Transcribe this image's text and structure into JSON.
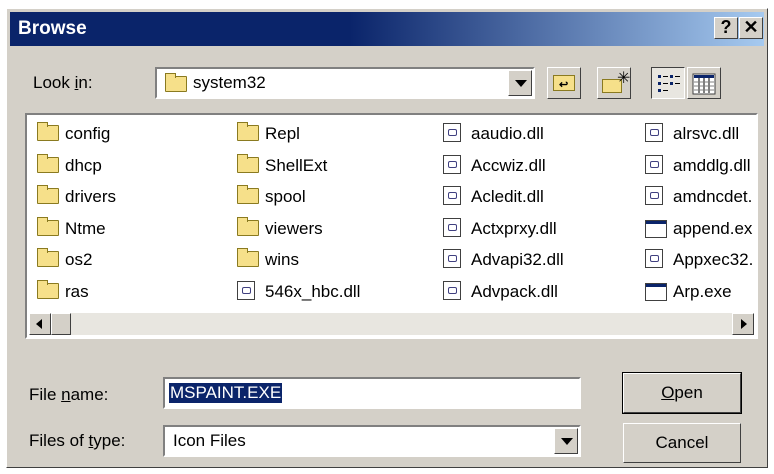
{
  "window": {
    "title": "Browse"
  },
  "titlebar": {
    "help_label": "?",
    "close_label": "✕"
  },
  "look_in": {
    "label_pre": "Look ",
    "label_key": "i",
    "label_post": "n:",
    "value": "system32"
  },
  "toolbar": {
    "icons": [
      "up-one-level-icon",
      "create-new-folder-icon",
      "list-view-icon",
      "details-view-icon"
    ]
  },
  "files": [
    {
      "name": "config",
      "type": "folder"
    },
    {
      "name": "dhcp",
      "type": "folder"
    },
    {
      "name": "drivers",
      "type": "folder"
    },
    {
      "name": "Ntme",
      "type": "folder"
    },
    {
      "name": "os2",
      "type": "folder"
    },
    {
      "name": "ras",
      "type": "folder"
    },
    {
      "name": "Repl",
      "type": "folder"
    },
    {
      "name": "ShellExt",
      "type": "folder"
    },
    {
      "name": "spool",
      "type": "folder"
    },
    {
      "name": "viewers",
      "type": "folder"
    },
    {
      "name": "wins",
      "type": "folder"
    },
    {
      "name": "546x_hbc.dll",
      "type": "dll"
    },
    {
      "name": "aaudio.dll",
      "type": "dll"
    },
    {
      "name": "Accwiz.dll",
      "type": "dll"
    },
    {
      "name": "Acledit.dll",
      "type": "dll"
    },
    {
      "name": "Actxprxy.dll",
      "type": "dll"
    },
    {
      "name": "Advapi32.dll",
      "type": "dll"
    },
    {
      "name": "Advpack.dll",
      "type": "dll"
    },
    {
      "name": "alrsvc.dll",
      "type": "dll"
    },
    {
      "name": "amddlg.dll",
      "type": "dll"
    },
    {
      "name": "amdncdet.",
      "type": "dll"
    },
    {
      "name": "append.ex",
      "type": "exe"
    },
    {
      "name": "Appxec32.",
      "type": "dll"
    },
    {
      "name": "Arp.exe",
      "type": "exe"
    }
  ],
  "file_name": {
    "label_pre": "File ",
    "label_key": "n",
    "label_post": "ame:",
    "value": "MSPAINT.EXE"
  },
  "file_type": {
    "label_pre": "Files of ",
    "label_key": "t",
    "label_post": "ype:",
    "value": "Icon Files"
  },
  "buttons": {
    "open_key": "O",
    "open_rest": "pen",
    "cancel": "Cancel"
  }
}
